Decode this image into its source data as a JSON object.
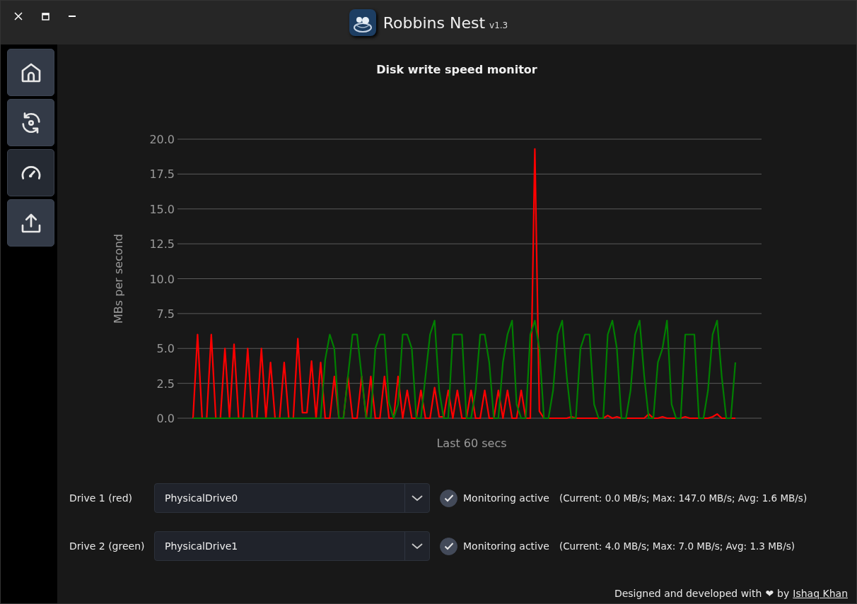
{
  "window": {
    "title": "Robbins Nest",
    "version": "v1.3"
  },
  "sidebar": {
    "items": [
      {
        "kind": "home",
        "selected": false
      },
      {
        "kind": "sync",
        "selected": false
      },
      {
        "kind": "gauge",
        "selected": true
      },
      {
        "kind": "upload",
        "selected": false
      }
    ]
  },
  "monitor": {
    "title": "Disk write speed monitor",
    "chart_data": {
      "type": "line",
      "grid": true,
      "xlabel": "Last 60 secs",
      "ylabel": "MBs per second",
      "ylim": [
        0,
        20
      ],
      "yticks": [
        {
          "value": 0,
          "label": "0.0"
        },
        {
          "value": 2.5,
          "label": "2.5"
        },
        {
          "value": 5,
          "label": "5.0"
        },
        {
          "value": 7.5,
          "label": "7.5"
        },
        {
          "value": 10,
          "label": "10.0"
        },
        {
          "value": 12.5,
          "label": "12.5"
        },
        {
          "value": 15,
          "label": "15.0"
        },
        {
          "value": 17.5,
          "label": "17.5"
        },
        {
          "value": 20,
          "label": "20.0"
        }
      ],
      "series": [
        {
          "color": "#ff0000",
          "values": [
            0,
            6,
            0,
            0,
            6,
            0,
            0,
            5,
            0,
            5.3,
            0,
            0,
            5,
            0,
            0,
            5,
            0,
            4,
            0,
            0,
            4,
            0,
            0,
            5.7,
            0.4,
            0.4,
            4.1,
            0,
            4,
            0,
            0,
            3,
            0,
            0,
            3,
            0,
            0,
            3,
            0,
            3,
            0,
            0,
            3,
            0,
            0,
            3,
            0,
            2,
            0,
            0,
            2,
            0,
            0,
            2.2,
            0.1,
            0.1,
            2,
            0,
            2,
            0,
            0,
            2,
            0,
            0,
            2,
            0,
            0,
            2,
            0,
            2,
            0,
            0,
            2,
            0,
            0,
            19.3,
            0.5,
            0,
            0,
            0,
            0,
            0,
            0,
            0.1,
            0,
            0,
            0,
            0,
            0,
            0,
            0,
            0.2,
            0,
            0.1,
            0,
            0,
            0,
            0,
            0,
            0,
            0.3,
            0,
            0,
            0.1,
            0,
            0,
            0,
            0,
            0.1,
            0,
            0,
            0,
            0,
            0,
            0.1,
            0.3,
            0,
            0,
            0,
            0
          ]
        },
        {
          "color": "#008000",
          "values": [
            0,
            0,
            0,
            0,
            0,
            0,
            0,
            0,
            0,
            0,
            0,
            0,
            0,
            0,
            0,
            0,
            0,
            0,
            0,
            0,
            0,
            0,
            0,
            0,
            0,
            0,
            0,
            0,
            0,
            4.2,
            6,
            5,
            0,
            0,
            3,
            6,
            6,
            3,
            0,
            0,
            5,
            6,
            6,
            1.1,
            0,
            1,
            6,
            6,
            5,
            0,
            0,
            3,
            6,
            7,
            2,
            0,
            0,
            6,
            6,
            6,
            0,
            0,
            2,
            6,
            6,
            4,
            0,
            0,
            4,
            6,
            7,
            1,
            0,
            0,
            6,
            7,
            5,
            0,
            0,
            2,
            6,
            7,
            3,
            0,
            0,
            5,
            6,
            6,
            1,
            0,
            0,
            6,
            7,
            5,
            0,
            0,
            2,
            6,
            7,
            3,
            0,
            0,
            4,
            5,
            7,
            1,
            0,
            0,
            6,
            6,
            6,
            0,
            0,
            2,
            6,
            7,
            3,
            0,
            0,
            4
          ]
        }
      ]
    }
  },
  "drives": [
    {
      "label": "Drive 1 (red)",
      "value": "PhysicalDrive0",
      "checked": true,
      "checkbox_label": "Monitoring active",
      "stats": "(Current: 0.0 MB/s; Max: 147.0 MB/s; Avg: 1.6 MB/s)"
    },
    {
      "label": "Drive 2 (green)",
      "value": "PhysicalDrive1",
      "checked": true,
      "checkbox_label": "Monitoring active",
      "stats": "(Current: 4.0 MB/s; Max: 7.0 MB/s; Avg: 1.3 MB/s)"
    }
  ],
  "footer": {
    "text": "Designed and developed with",
    "heart": "❤",
    "by": "by",
    "link": "Ishaq Khan"
  }
}
